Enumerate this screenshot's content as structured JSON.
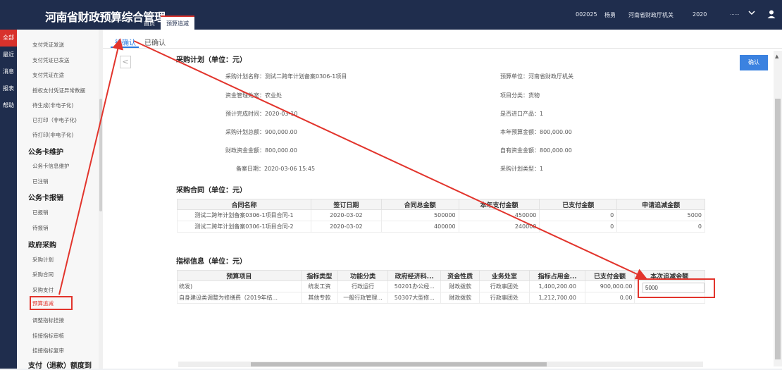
{
  "header": {
    "title": "河南省财政预算综合管理",
    "tabs": [
      "首页",
      "预算追减"
    ],
    "user_code": "002025",
    "user_name": "杨勇",
    "org": "河南省财政厅机关",
    "year": "2020",
    "dropdown": "......"
  },
  "leftnav": [
    "全部",
    "最近",
    "消息",
    "报表",
    "帮助"
  ],
  "sidebar": {
    "items": [
      {
        "label": "支付凭证发送",
        "type": "item"
      },
      {
        "label": "支付凭证已发送",
        "type": "item"
      },
      {
        "label": "支付凭证在途",
        "type": "item"
      },
      {
        "label": "授权支付凭证异常数据",
        "type": "item"
      },
      {
        "label": "待生成(非电子化)",
        "type": "item"
      },
      {
        "label": "已打印（非电子化)",
        "type": "item"
      },
      {
        "label": "待打印(非电子化)",
        "type": "item"
      },
      {
        "label": "公务卡维护",
        "type": "heading"
      },
      {
        "label": "公务卡信息维护",
        "type": "item"
      },
      {
        "label": "已注销",
        "type": "item"
      },
      {
        "label": "公务卡报销",
        "type": "heading"
      },
      {
        "label": "已报销",
        "type": "item"
      },
      {
        "label": "待报销",
        "type": "item"
      },
      {
        "label": "政府采购",
        "type": "heading"
      },
      {
        "label": "采购计划",
        "type": "item"
      },
      {
        "label": "采购合同",
        "type": "item"
      },
      {
        "label": "采购支付",
        "type": "item"
      },
      {
        "label": "预算追减",
        "type": "active"
      },
      {
        "label": "调整指标挂接",
        "type": "item"
      },
      {
        "label": "挂接指标审核",
        "type": "item"
      },
      {
        "label": "挂接指标复审",
        "type": "item"
      },
      {
        "label": "支付（退款）额度到",
        "type": "heading"
      }
    ]
  },
  "subtabs": {
    "pending": "待确认",
    "confirmed": "已确认"
  },
  "confirm_label": "确认",
  "back_arrow": "<",
  "plan": {
    "section_title": "采购计划（单位：元）",
    "fields": [
      {
        "k": "采购计划名称：",
        "v": "测试二跨年计划备案0306-1项目"
      },
      {
        "k": "预算单位：",
        "v": "河南省财政厅机关"
      },
      {
        "k": "资金管理处室：",
        "v": "农业处"
      },
      {
        "k": "项目分类：",
        "v": "货物"
      },
      {
        "k": "预计完成时间：",
        "v": "2020-03-10"
      },
      {
        "k": "是否进口产品：",
        "v": "1"
      },
      {
        "k": "采购计划总额：",
        "v": "900,000.00"
      },
      {
        "k": "本年预算金额：",
        "v": "800,000.00"
      },
      {
        "k": "财政资金金额：",
        "v": "800,000.00"
      },
      {
        "k": "自有资金金额：",
        "v": "800,000.00"
      },
      {
        "k": "备案日期：",
        "v": "2020-03-06 15:45"
      },
      {
        "k": "采购计划类型：",
        "v": "1"
      }
    ]
  },
  "contract": {
    "section_title": "采购合同（单位：元）",
    "headers": [
      "合同名称",
      "签订日期",
      "合同总金额",
      "本年支付金额",
      "已支付金额",
      "申请追减金额"
    ],
    "rows": [
      [
        "测试二跨年计划备案0306-1项目合同-1",
        "2020-03-02",
        "500000",
        "450000",
        "0",
        "5000"
      ],
      [
        "测试二跨年计划备案0306-1项目合同-2",
        "2020-03-02",
        "400000",
        "240000",
        "0",
        "0"
      ]
    ]
  },
  "indicator": {
    "section_title": "指标信息（单位：元）",
    "headers": [
      "预算项目",
      "指标类型",
      "功能分类",
      "政府经济科...",
      "资金性质",
      "业务处室",
      "指标占用金...",
      "已支付金额",
      "本次追减金额"
    ],
    "rows": [
      [
        "统发)",
        "统发工资",
        "行政运行",
        "50201办公经...",
        "财政拨款",
        "行政事团处",
        "1,400,200.00",
        "900,000.00",
        ""
      ],
      [
        "自身建设类调整为修缮费（2019年结...",
        "其他专款",
        "一般行政管理...",
        "50307大型修...",
        "财政拨款",
        "行政事团处",
        "1,212,700.00",
        "0.00",
        ""
      ]
    ],
    "deduct_value": "5000"
  },
  "colors": {
    "nav_bg": "#1f2d4d",
    "accent": "#2a7adf",
    "alert": "#e2342c"
  }
}
